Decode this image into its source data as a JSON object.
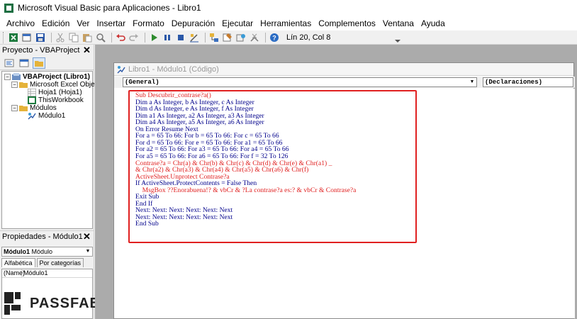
{
  "window": {
    "title": "Microsoft Visual Basic para Aplicaciones - Libro1"
  },
  "menu": [
    "Archivo",
    "Edición",
    "Ver",
    "Insertar",
    "Formato",
    "Depuración",
    "Ejecutar",
    "Herramientas",
    "Complementos",
    "Ventana",
    "Ayuda"
  ],
  "toolbar": {
    "position": "Lín 20, Col 8"
  },
  "project_pane": {
    "title": "Proyecto - VBAProject",
    "tree": [
      {
        "label": "VBAProject (Libro1)",
        "bold": true
      },
      {
        "label": "Microsoft Excel Objetos"
      },
      {
        "label": "Hoja1 (Hoja1)"
      },
      {
        "label": "ThisWorkbook"
      },
      {
        "label": "Módulos"
      },
      {
        "label": "Módulo1"
      }
    ]
  },
  "properties_pane": {
    "title": "Propiedades - Módulo1",
    "object_name": "Módulo1",
    "object_type": "Módulo",
    "tabs": [
      "Alfabética",
      "Por categorías"
    ],
    "rows": [
      {
        "key": "(Name)",
        "value": "Módulo1"
      }
    ]
  },
  "brand": {
    "name": "PASSFAB"
  },
  "code_window": {
    "title": "Libro1 - Módulo1 (Código)",
    "object_combo": "(General)",
    "proc_combo": "(Declaraciones)",
    "lines": [
      {
        "text": "Sub Descubrir_contrase?a()",
        "color": "red"
      },
      {
        "text": "Dim a As Integer, b As Integer, c As Integer"
      },
      {
        "text": "Dim d As Integer, e As Integer, f As Integer"
      },
      {
        "text": "Dim a1 As Integer, a2 As Integer, a3 As Integer"
      },
      {
        "text": "Dim a4 As Integer, a5 As Integer, a6 As Integer"
      },
      {
        "text": "On Error Resume Next"
      },
      {
        "text": "For a = 65 To 66: For b = 65 To 66: For c = 65 To 66"
      },
      {
        "text": "For d = 65 To 66: For e = 65 To 66: For a1 = 65 To 66"
      },
      {
        "text": "For a2 = 65 To 66: For a3 = 65 To 66: For a4 = 65 To 66"
      },
      {
        "text": "For a5 = 65 To 66: For a6 = 65 To 66: For f = 32 To 126"
      },
      {
        "text": "Contrase?a = Chr(a) & Chr(b) & Chr(c) & Chr(d) & Chr(e) & Chr(a1) _",
        "color": "red"
      },
      {
        "text": "& Chr(a2) & Chr(a3) & Chr(a4) & Chr(a5) & Chr(a6) & Chr(f)",
        "color": "red"
      },
      {
        "text": "ActiveSheet.Unprotect Contrase?a",
        "color": "red"
      },
      {
        "text": "If ActiveSheet.ProtectContents = False Then"
      },
      {
        "text": "    MsgBox ??Enorabuena!? & vbCr & ?La contrase?a es:? & vbCr & Contrase?a",
        "color": "red"
      },
      {
        "text": "Exit Sub"
      },
      {
        "text": "End If"
      },
      {
        "text": "Next: Next: Next: Next: Next: Next"
      },
      {
        "text": "Next: Next: Next: Next: Next: Next"
      },
      {
        "text": "End Sub"
      }
    ]
  },
  "colors": {
    "highlight_box": "#e02020",
    "code_text": "#00008b",
    "mdi_background": "#ababab"
  }
}
